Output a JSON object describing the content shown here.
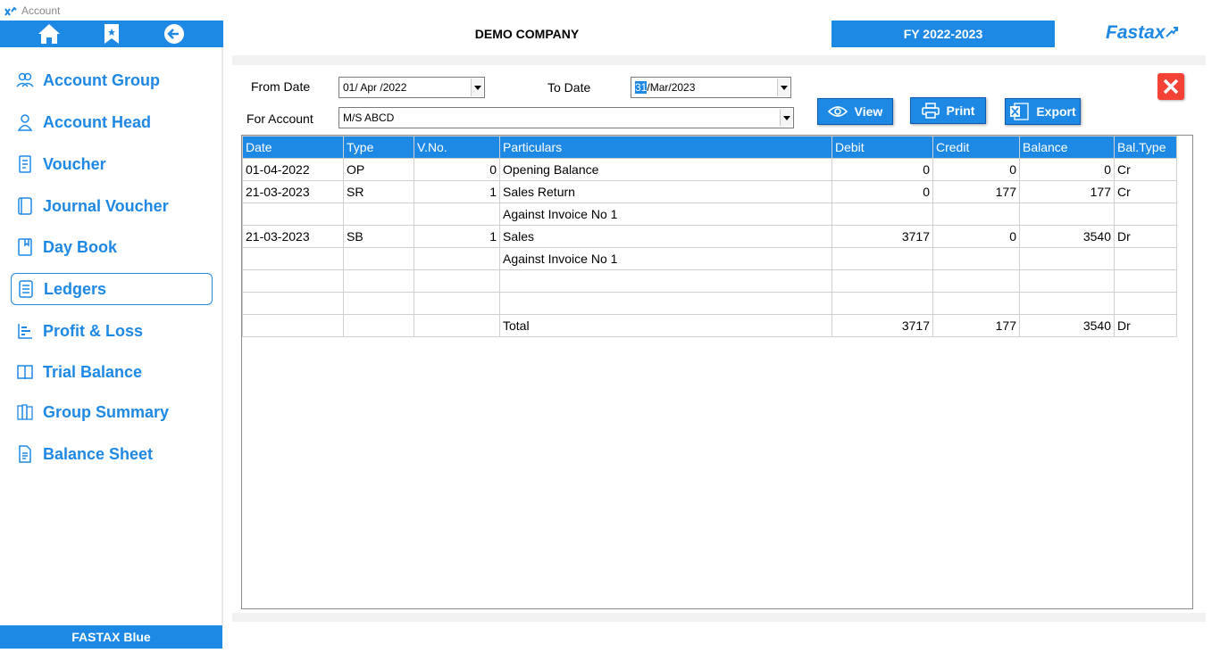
{
  "window": {
    "title": "Account"
  },
  "header": {
    "company": "DEMO COMPANY",
    "fy": "FY 2022-2023",
    "brand": "Fastax"
  },
  "sidebar": {
    "items": [
      {
        "label": "Account Group",
        "icon": "users-icon"
      },
      {
        "label": "Account Head",
        "icon": "user-icon"
      },
      {
        "label": "Voucher",
        "icon": "receipt-icon"
      },
      {
        "label": "Journal Voucher",
        "icon": "journal-icon"
      },
      {
        "label": "Day Book",
        "icon": "book-icon"
      },
      {
        "label": "Ledgers",
        "icon": "ledger-icon"
      },
      {
        "label": "Profit & Loss",
        "icon": "bars-icon"
      },
      {
        "label": "Trial Balance",
        "icon": "open-book-icon"
      },
      {
        "label": "Group Summary",
        "icon": "books-icon"
      },
      {
        "label": "Balance Sheet",
        "icon": "document-icon"
      }
    ],
    "active": "Ledgers"
  },
  "footer": {
    "label": "FASTAX Blue"
  },
  "filters": {
    "from_date_label": "From Date",
    "from_date_value": "01/ Apr /2022",
    "to_date_label": "To Date",
    "to_date_day": "31",
    "to_date_rest": "/Mar/2023",
    "account_label": "For Account",
    "account_value": "M/S ABCD"
  },
  "buttons": {
    "view": "View",
    "print": "Print",
    "export": "Export"
  },
  "table": {
    "headers": [
      "Date",
      "Type",
      "V.No.",
      "Particulars",
      "Debit",
      "Credit",
      "Balance",
      "Bal.Type"
    ],
    "rows": [
      [
        "01-04-2022",
        "OP",
        "0",
        "Opening Balance",
        "0",
        "0",
        "0",
        "Cr"
      ],
      [
        "21-03-2023",
        "SR",
        "1",
        "Sales Return",
        "0",
        "177",
        "177",
        "Cr"
      ],
      [
        "",
        "",
        "",
        "Against Invoice No 1",
        "",
        "",
        "",
        ""
      ],
      [
        "21-03-2023",
        "SB",
        "1",
        "Sales",
        "3717",
        "0",
        "3540",
        "Dr"
      ],
      [
        "",
        "",
        "",
        "Against Invoice No 1",
        "",
        "",
        "",
        ""
      ],
      [
        "",
        "",
        "",
        "",
        "",
        "",
        "",
        ""
      ],
      [
        "",
        "",
        "",
        "",
        "",
        "",
        "",
        ""
      ],
      [
        "",
        "",
        "",
        "Total",
        "3717",
        "177",
        "3540",
        "Dr"
      ]
    ]
  },
  "colors": {
    "accent": "#1e88e5",
    "close": "#f44336"
  }
}
